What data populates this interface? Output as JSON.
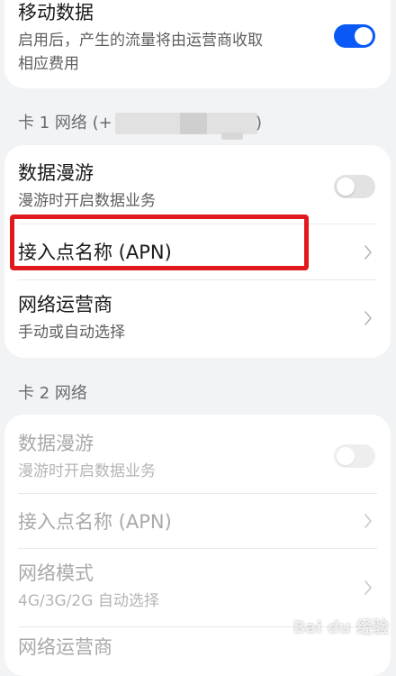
{
  "mobile_data": {
    "title": "移动数据",
    "subtitle_line1": "启用后，产生的流量将由运营商收取",
    "subtitle_line2": "相应费用",
    "enabled": true
  },
  "sim1": {
    "label": "卡 1 网络 (+",
    "label_close": ")",
    "roaming": {
      "title": "数据漫游",
      "subtitle": "漫游时开启数据业务",
      "enabled": false
    },
    "apn": {
      "title": "接入点名称 (APN)"
    },
    "operator": {
      "title": "网络运营商",
      "subtitle": "手动或自动选择"
    }
  },
  "sim2": {
    "label": "卡 2 网络",
    "roaming": {
      "title": "数据漫游",
      "subtitle": "漫游时开启数据业务",
      "enabled": false
    },
    "apn": {
      "title": "接入点名称 (APN)"
    },
    "network_mode": {
      "title": "网络模式",
      "subtitle": "4G/3G/2G 自动选择"
    },
    "operator": {
      "title": "网络运营商"
    }
  },
  "watermark": "Bai du 经验",
  "colors": {
    "accent": "#0a59f7",
    "highlight": "#e0191e",
    "background": "#f1f3f5"
  }
}
